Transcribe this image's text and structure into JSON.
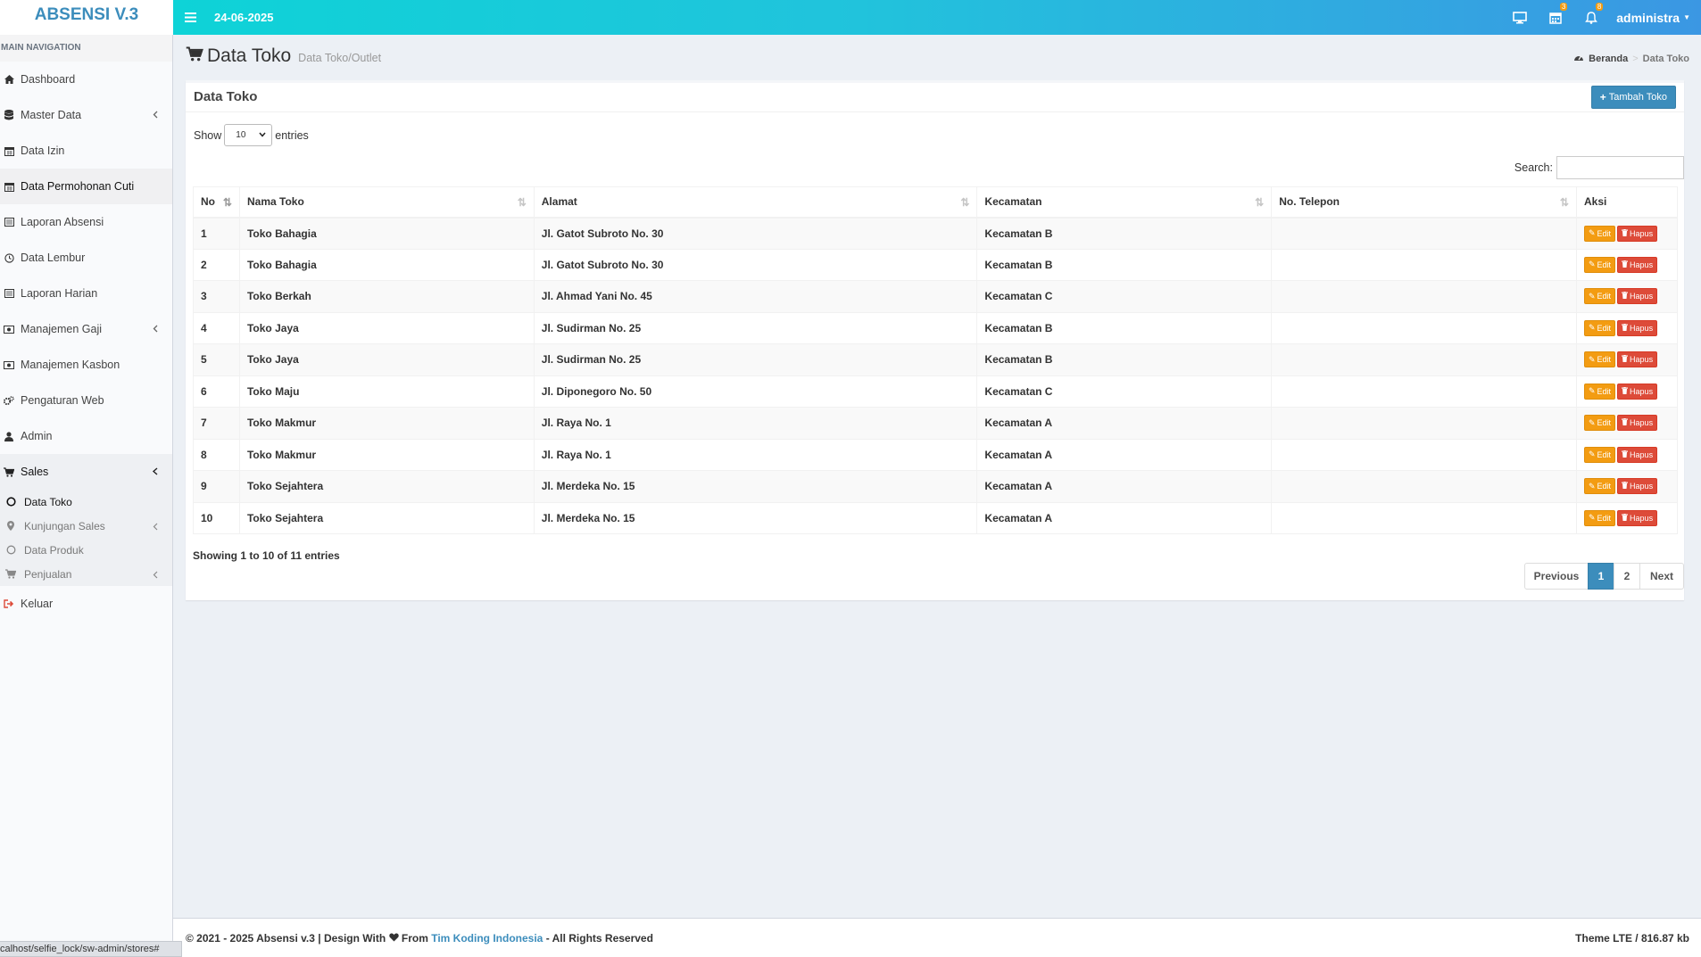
{
  "app": {
    "logo": "ABSENSI V.3",
    "date": "24-06-2025",
    "user": "administra"
  },
  "header": {
    "badges": {
      "calendar": "3",
      "bell": "8"
    }
  },
  "sidebar": {
    "header": "MAIN NAVIGATION",
    "items": [
      {
        "label": "Dashboard",
        "icon": "home-icon"
      },
      {
        "label": "Master Data",
        "icon": "database-icon",
        "chevron": true
      },
      {
        "label": "Data Izin",
        "icon": "calendar-icon"
      },
      {
        "label": "Data Permohonan Cuti",
        "icon": "calendar-icon"
      },
      {
        "label": "Laporan Absensi",
        "icon": "list-icon"
      },
      {
        "label": "Data Lembur",
        "icon": "clock-icon"
      },
      {
        "label": "Laporan Harian",
        "icon": "list-icon"
      },
      {
        "label": "Manajemen Gaji",
        "icon": "money-icon",
        "chevron": true
      },
      {
        "label": "Manajemen Kasbon",
        "icon": "money-icon"
      },
      {
        "label": "Pengaturan Web",
        "icon": "gears-icon"
      },
      {
        "label": "Admin",
        "icon": "user-icon"
      },
      {
        "label": "Sales",
        "icon": "cart-icon",
        "chevron": true
      }
    ],
    "sales_sub": [
      {
        "label": "Data Toko",
        "icon": "circle-icon"
      },
      {
        "label": "Kunjungan Sales",
        "icon": "map-marker-icon"
      },
      {
        "label": "Data Produk",
        "icon": "circle-icon"
      },
      {
        "label": "Penjualan",
        "icon": "cart-icon"
      }
    ],
    "logout": "Keluar"
  },
  "page": {
    "title": "Data Toko",
    "subtitle": "Data Toko/Outlet",
    "breadcrumb": {
      "home": "Beranda",
      "current": "Data Toko"
    }
  },
  "box": {
    "title": "Data Toko",
    "add_button": "Tambah Toko",
    "show_label": "Show",
    "show_value": "10",
    "entries_label": "entries",
    "search_label": "Search:",
    "search_value": "",
    "columns": [
      "No",
      "Nama Toko",
      "Alamat",
      "Kecamatan",
      "No. Telepon",
      "Aksi"
    ],
    "edit_label": "Edit",
    "delete_label": "Hapus",
    "rows": [
      {
        "no": "1",
        "nama": "Toko Bahagia",
        "alamat": "Jl. Gatot Subroto No. 30",
        "kecamatan": "Kecamatan B",
        "telepon": ""
      },
      {
        "no": "2",
        "nama": "Toko Bahagia",
        "alamat": "Jl. Gatot Subroto No. 30",
        "kecamatan": "Kecamatan B",
        "telepon": ""
      },
      {
        "no": "3",
        "nama": "Toko Berkah",
        "alamat": "Jl. Ahmad Yani No. 45",
        "kecamatan": "Kecamatan C",
        "telepon": ""
      },
      {
        "no": "4",
        "nama": "Toko Jaya",
        "alamat": "Jl. Sudirman No. 25",
        "kecamatan": "Kecamatan B",
        "telepon": ""
      },
      {
        "no": "5",
        "nama": "Toko Jaya",
        "alamat": "Jl. Sudirman No. 25",
        "kecamatan": "Kecamatan B",
        "telepon": ""
      },
      {
        "no": "6",
        "nama": "Toko Maju",
        "alamat": "Jl. Diponegoro No. 50",
        "kecamatan": "Kecamatan C",
        "telepon": ""
      },
      {
        "no": "7",
        "nama": "Toko Makmur",
        "alamat": "Jl. Raya No. 1",
        "kecamatan": "Kecamatan A",
        "telepon": ""
      },
      {
        "no": "8",
        "nama": "Toko Makmur",
        "alamat": "Jl. Raya No. 1",
        "kecamatan": "Kecamatan A",
        "telepon": ""
      },
      {
        "no": "9",
        "nama": "Toko Sejahtera",
        "alamat": "Jl. Merdeka No. 15",
        "kecamatan": "Kecamatan A",
        "telepon": ""
      },
      {
        "no": "10",
        "nama": "Toko Sejahtera",
        "alamat": "Jl. Merdeka No. 15",
        "kecamatan": "Kecamatan A",
        "telepon": ""
      }
    ],
    "info": "Showing 1 to 10 of 11 entries",
    "pagination": {
      "prev": "Previous",
      "pages": [
        "1",
        "2"
      ],
      "current": "1",
      "next": "Next"
    }
  },
  "footer": {
    "left_pre": "© 2021 - 2025 Absensi v.3 | Design With",
    "left_from": "From",
    "link": "Tim Koding Indonesia",
    "left_post": "- All Rights Reserved",
    "right": "Theme LTE / 816.87 kb"
  },
  "status_url": "calhost/selfie_lock/sw-admin/stores#",
  "colors": {
    "primary": "#3c8dbc",
    "warning": "#f39c12",
    "danger": "#dd4b39",
    "header_start": "#0ed3d7",
    "header_end": "#3b97e3"
  }
}
